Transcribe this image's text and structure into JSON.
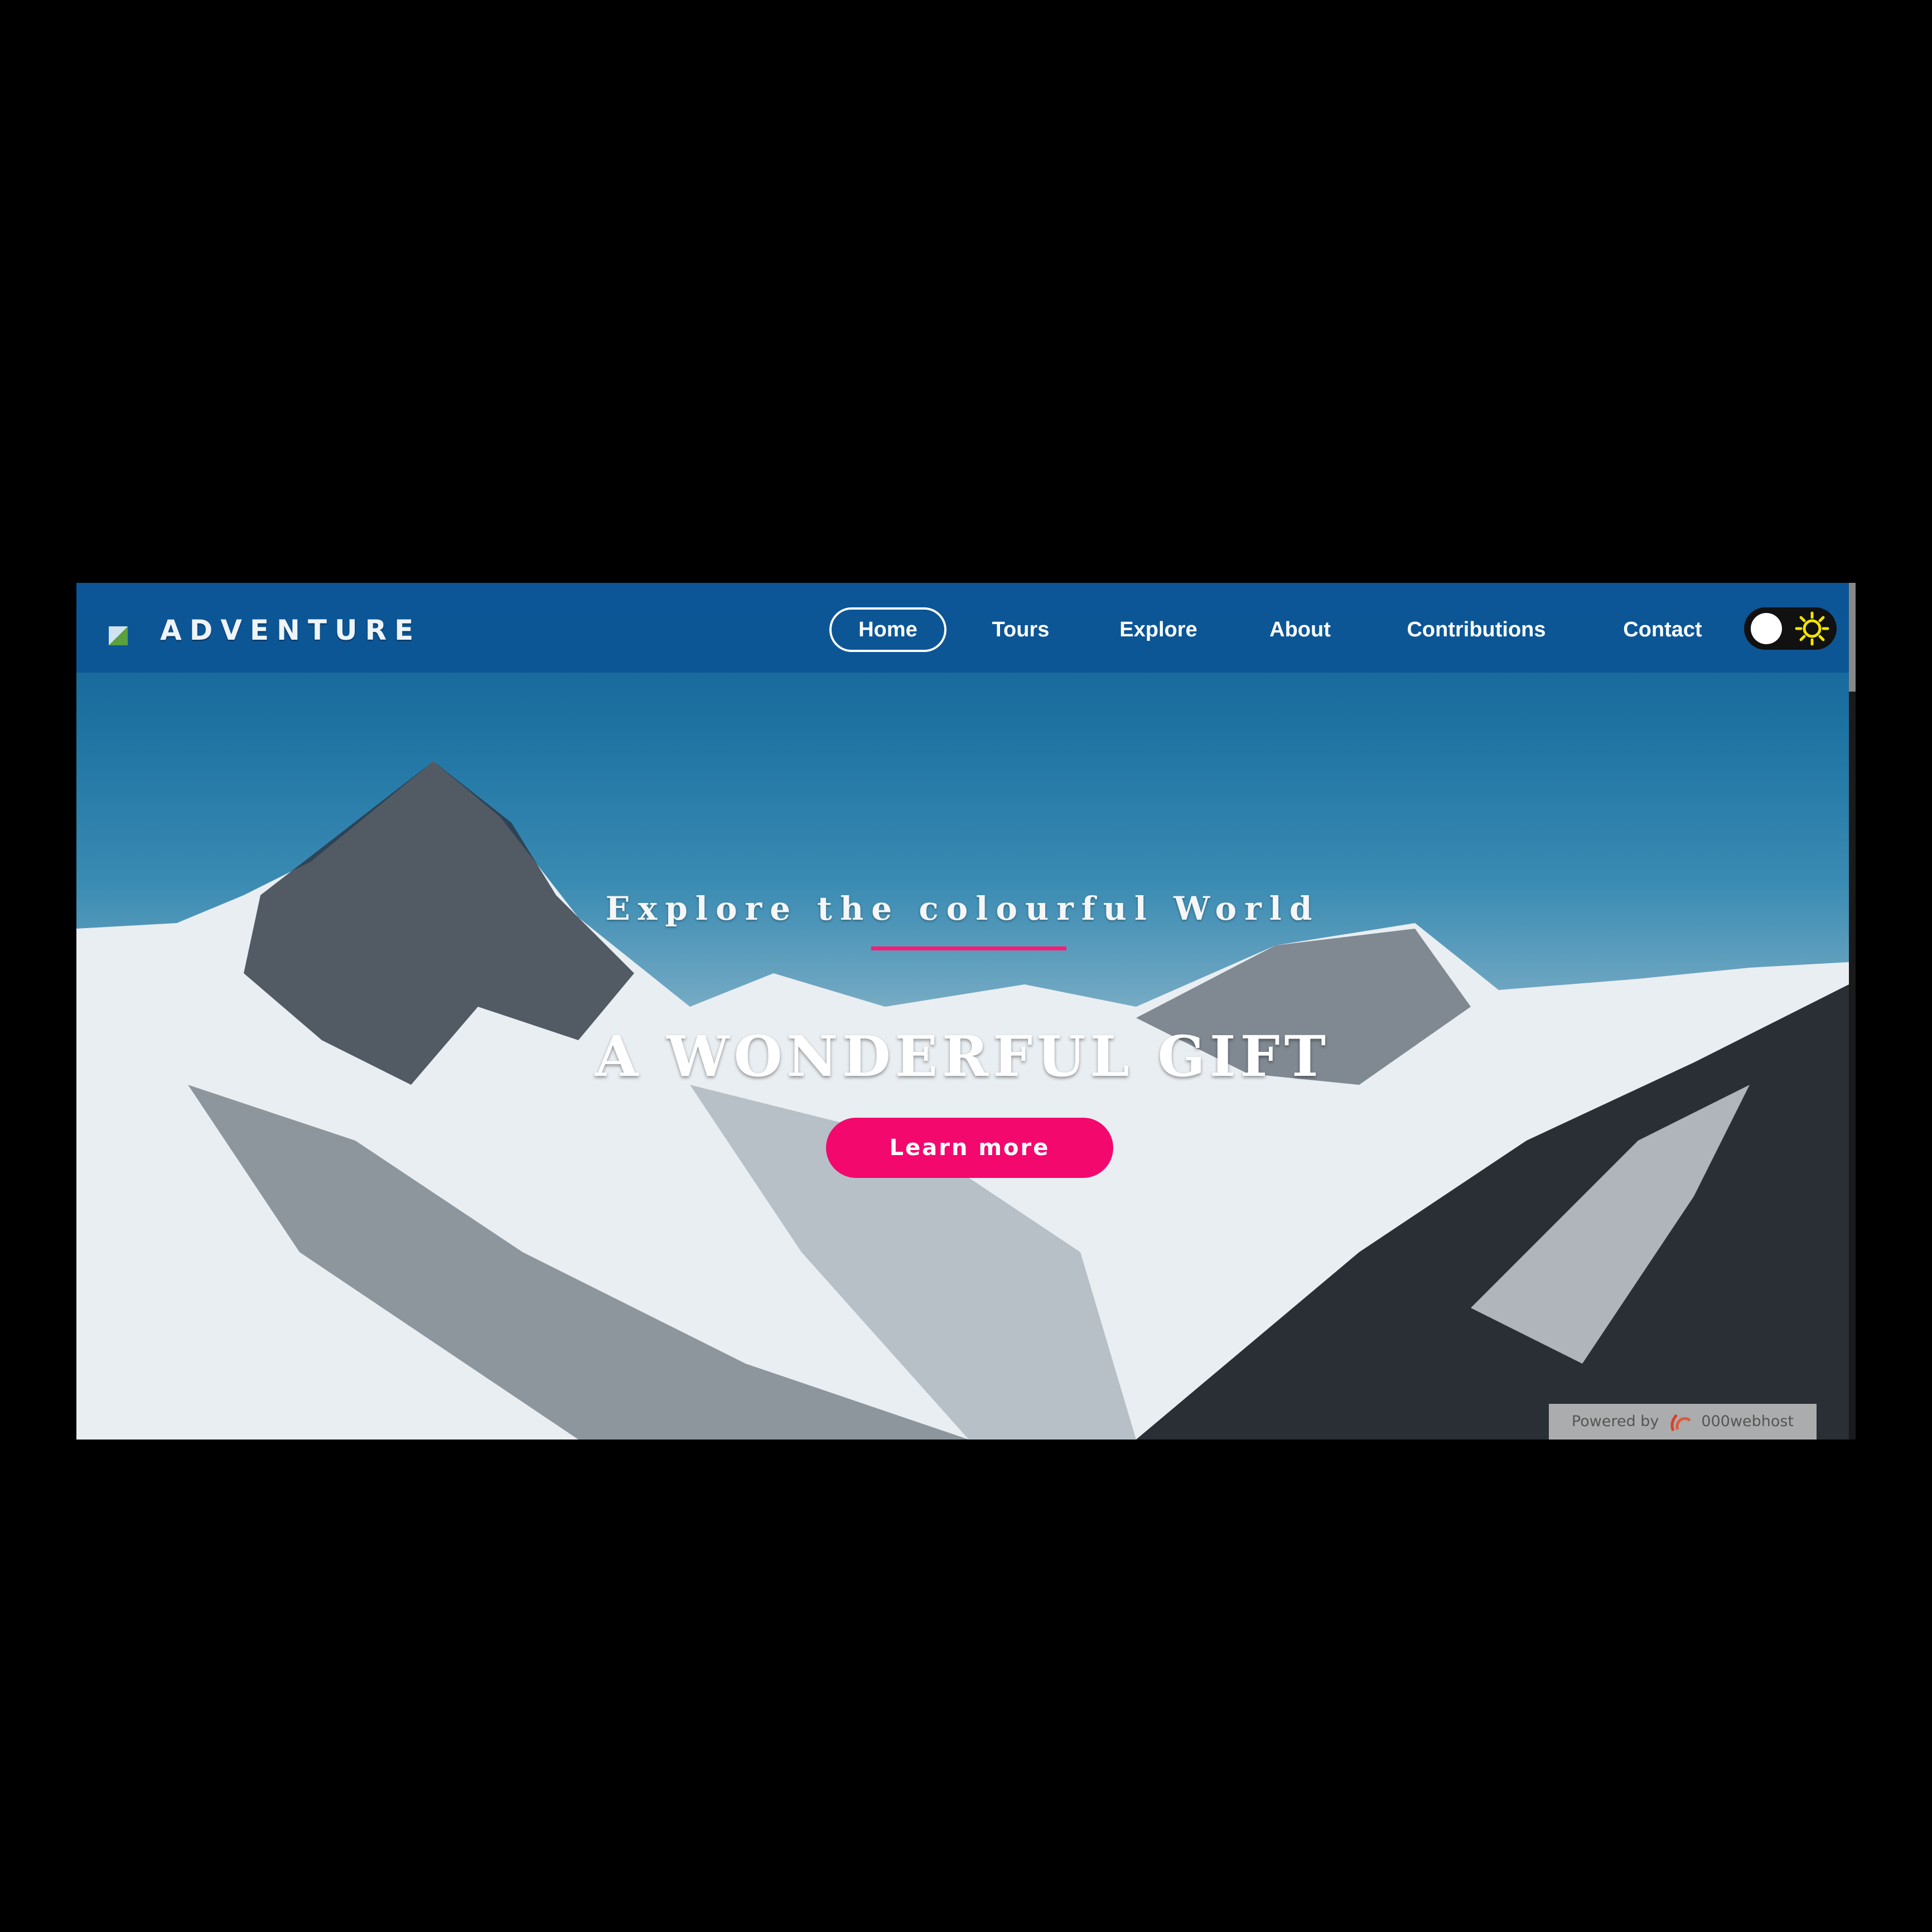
{
  "brand": {
    "name": "ADVENTURE",
    "logo_icon": "broken-image-icon"
  },
  "nav": {
    "items": [
      {
        "label": "Home",
        "active": true
      },
      {
        "label": "Tours"
      },
      {
        "label": "Explore"
      },
      {
        "label": "About"
      },
      {
        "label": "Contributions"
      },
      {
        "label": "Contact"
      }
    ],
    "theme_toggle": {
      "state": "light",
      "icon": "sun-icon"
    }
  },
  "hero": {
    "subtitle": "Explore the colourful World",
    "title": "A WONDERFUL GIFT",
    "cta_label": "Learn more"
  },
  "footer_badge": {
    "prefix": "Powered by",
    "host": "000webhost"
  },
  "colors": {
    "nav_bg": "#0c5596",
    "accent": "#f3086e",
    "sun": "#f2e600"
  }
}
